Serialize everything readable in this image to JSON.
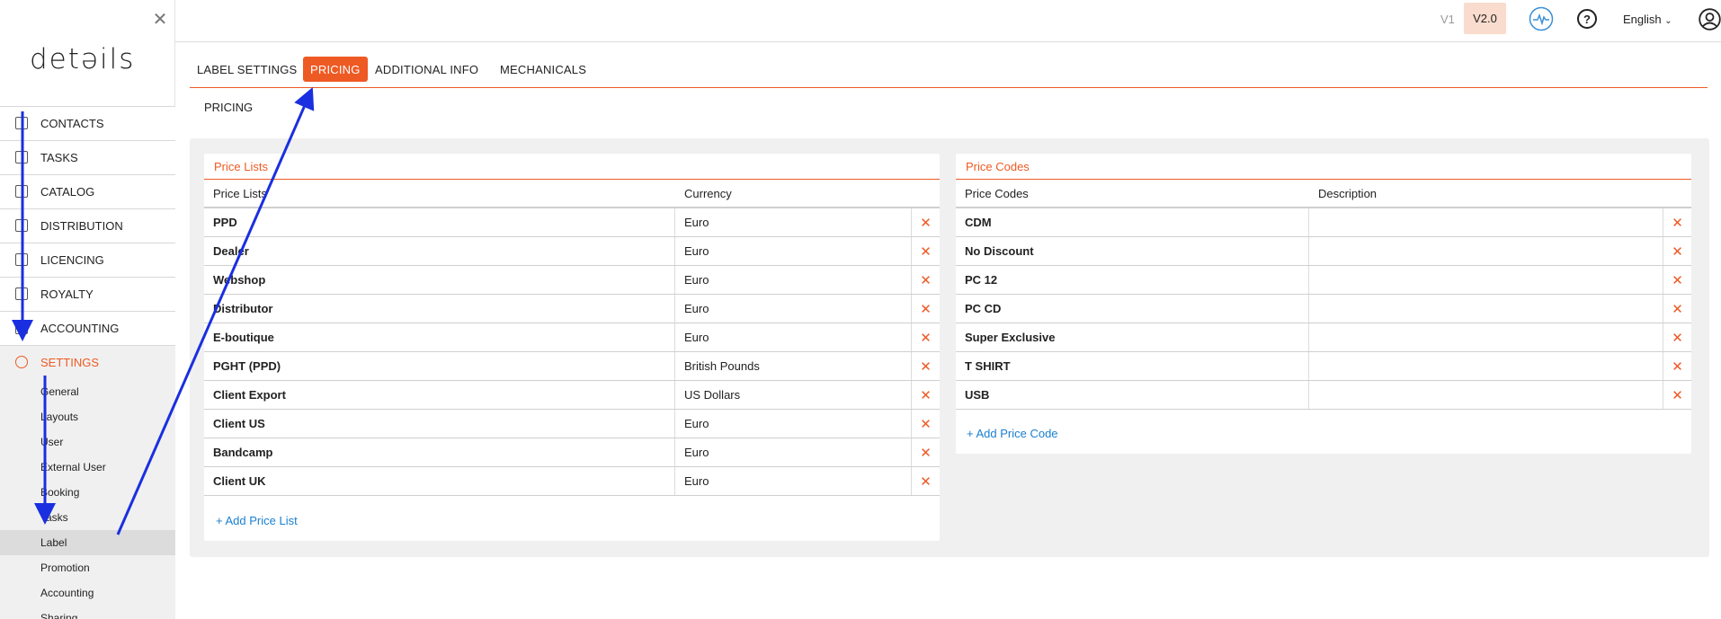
{
  "sidebar": {
    "logo": "detǝils",
    "items": [
      {
        "label": "CONTACTS",
        "icon": "contacts-icon"
      },
      {
        "label": "TASKS",
        "icon": "clipboard-icon"
      },
      {
        "label": "CATALOG",
        "icon": "catalog-icon"
      },
      {
        "label": "DISTRIBUTION",
        "icon": "distribution-icon"
      },
      {
        "label": "LICENCING",
        "icon": "licence-icon"
      },
      {
        "label": "ROYALTY",
        "icon": "royalty-icon"
      },
      {
        "label": "ACCOUNTING",
        "icon": "accounting-icon"
      },
      {
        "label": "SETTINGS",
        "icon": "gear-icon"
      }
    ],
    "sub_items": [
      "General",
      "Layouts",
      "User",
      "External User",
      "Booking",
      "Tasks",
      "Label",
      "Promotion",
      "Accounting",
      "Sharing"
    ],
    "active_sub": "Label"
  },
  "topbar": {
    "v1": "V1",
    "v2": "V2.0",
    "language": "English"
  },
  "tabs": [
    "LABEL SETTINGS",
    "PRICING",
    "ADDITIONAL INFO",
    "MECHANICALS"
  ],
  "active_tab": "PRICING",
  "subheading": "PRICING",
  "price_lists": {
    "title": "Price Lists",
    "headers": [
      "Price Lists",
      "Currency"
    ],
    "rows": [
      {
        "name": "PPD",
        "currency": "Euro"
      },
      {
        "name": "Dealer",
        "currency": "Euro"
      },
      {
        "name": "Webshop",
        "currency": "Euro"
      },
      {
        "name": "Distributor",
        "currency": "Euro"
      },
      {
        "name": "E-boutique",
        "currency": "Euro"
      },
      {
        "name": "PGHT (PPD)",
        "currency": "British Pounds"
      },
      {
        "name": "Client Export",
        "currency": "US Dollars"
      },
      {
        "name": "Client US",
        "currency": "Euro"
      },
      {
        "name": "Bandcamp",
        "currency": "Euro"
      },
      {
        "name": "Client UK",
        "currency": "Euro"
      }
    ],
    "add_label": "+ Add Price List"
  },
  "price_codes": {
    "title": "Price Codes",
    "headers": [
      "Price Codes",
      "Description"
    ],
    "rows": [
      {
        "name": "CDM",
        "description": ""
      },
      {
        "name": "No Discount",
        "description": ""
      },
      {
        "name": "PC 12",
        "description": ""
      },
      {
        "name": "PC CD",
        "description": ""
      },
      {
        "name": "Super Exclusive",
        "description": ""
      },
      {
        "name": "T SHIRT",
        "description": ""
      },
      {
        "name": "USB",
        "description": ""
      }
    ],
    "add_label": "+ Add Price Code"
  },
  "colors": {
    "accent": "#ee5a24",
    "link": "#1a7fd0",
    "annotation_arrow": "#1a2fe0"
  }
}
